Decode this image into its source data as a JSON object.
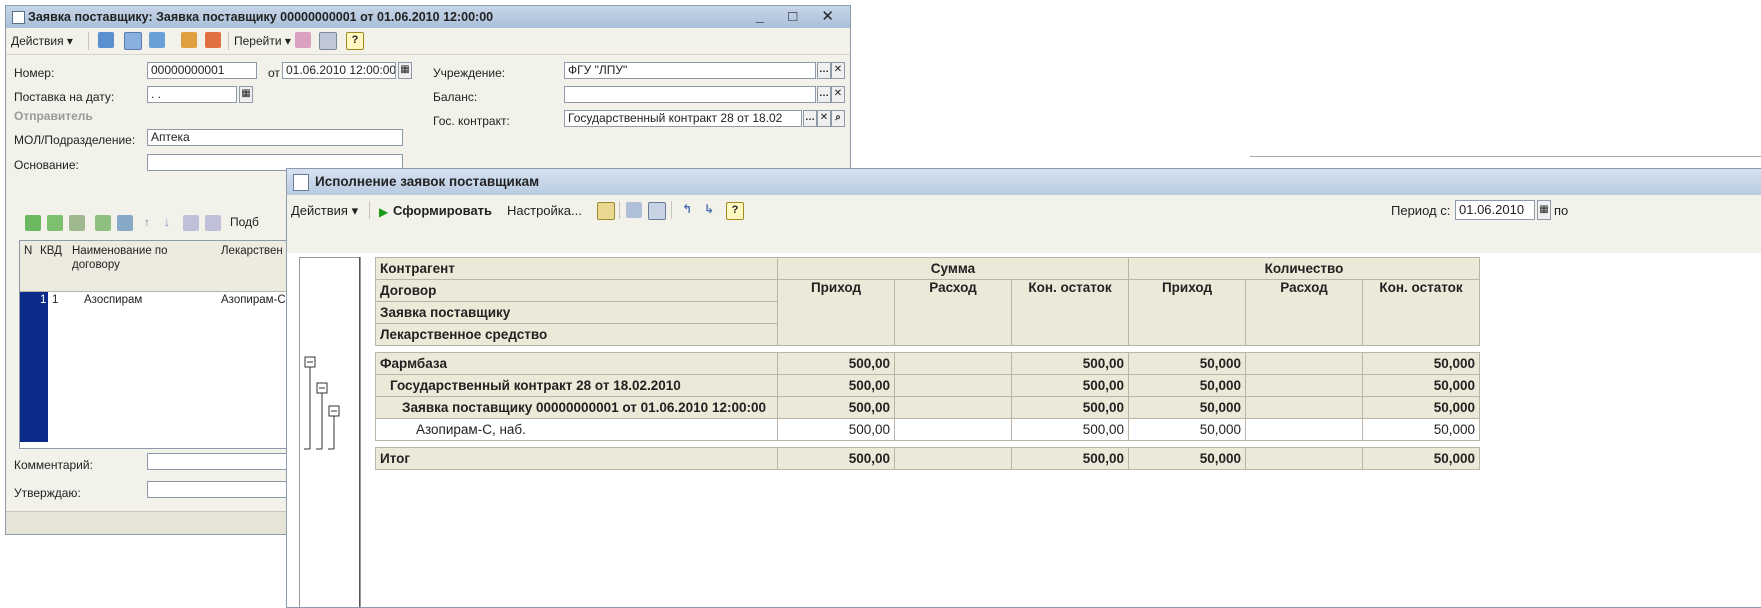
{
  "win1": {
    "title": "Заявка поставщику: Заявка поставщику 00000000001 от 01.06.2010 12:00:00",
    "toolbar": {
      "actions": "Действия ▾",
      "goto": "Перейти ▾",
      "help": "?"
    },
    "fields": {
      "nomer_label": "Номер:",
      "nomer_value": "00000000001",
      "ot_label": "от",
      "ot_value": "01.06.2010 12:00:00",
      "postavka_label": "Поставка на дату:",
      "postavka_value": " . .",
      "sender_group": "Отправитель",
      "mol_label": "МОЛ/Подразделение:",
      "mol_value": "Аптека",
      "osnovanie_label": "Основание:",
      "uchr_label": "Учреждение:",
      "uchr_value": "ФГУ \"ЛПУ\"",
      "balans_label": "Баланс:",
      "goscontr_label": "Гос. контракт:",
      "goscontr_value": "Государственный контракт 28 от 18.02",
      "comment_label": "Комментарий:",
      "utv_label": "Утверждаю:",
      "podb": "Подб"
    },
    "grid": {
      "col_n": "N",
      "col_kvd": "КВД",
      "col_name": "Наименование по договору",
      "col_lek": "Лекарствен",
      "row": {
        "n": "1",
        "kvd": "1",
        "name": "Азоспирам",
        "lek": "Азопирам-С"
      }
    }
  },
  "win2": {
    "title": "Исполнение заявок поставщикам",
    "toolbar": {
      "actions": "Действия ▾",
      "form": "Сформировать",
      "settings": "Настройка...",
      "help": "?",
      "period_label": "Период с:",
      "period_value": "01.06.2010",
      "po": "по"
    },
    "header": {
      "c1": "Контрагент",
      "c2": "Договор",
      "c3": "Заявка поставщику",
      "c4": "Лекарственное средство",
      "summa": "Сумма",
      "kolvo": "Количество",
      "prihod": "Приход",
      "rashod": "Расход",
      "ostatok": "Кон. остаток"
    },
    "rows": [
      {
        "name": "Фармбаза",
        "s_in": "500,00",
        "s_out": "",
        "s_rest": "500,00",
        "q_in": "50,000",
        "q_out": "",
        "q_rest": "50,000"
      },
      {
        "name": "Государственный контракт 28 от 18.02.2010",
        "s_in": "500,00",
        "s_out": "",
        "s_rest": "500,00",
        "q_in": "50,000",
        "q_out": "",
        "q_rest": "50,000"
      },
      {
        "name": "Заявка поставщику 00000000001 от 01.06.2010 12:00:00",
        "s_in": "500,00",
        "s_out": "",
        "s_rest": "500,00",
        "q_in": "50,000",
        "q_out": "",
        "q_rest": "50,000"
      },
      {
        "name": "Азопирам-С, наб.",
        "s_in": "500,00",
        "s_out": "",
        "s_rest": "500,00",
        "q_in": "50,000",
        "q_out": "",
        "q_rest": "50,000"
      }
    ],
    "total": {
      "name": "Итог",
      "s_in": "500,00",
      "s_out": "",
      "s_rest": "500,00",
      "q_in": "50,000",
      "q_out": "",
      "q_rest": "50,000"
    }
  },
  "colors": {
    "title_grad": "#b8cbe2",
    "grid_header": "#ece9d8",
    "selection": "#0b2a8a"
  }
}
